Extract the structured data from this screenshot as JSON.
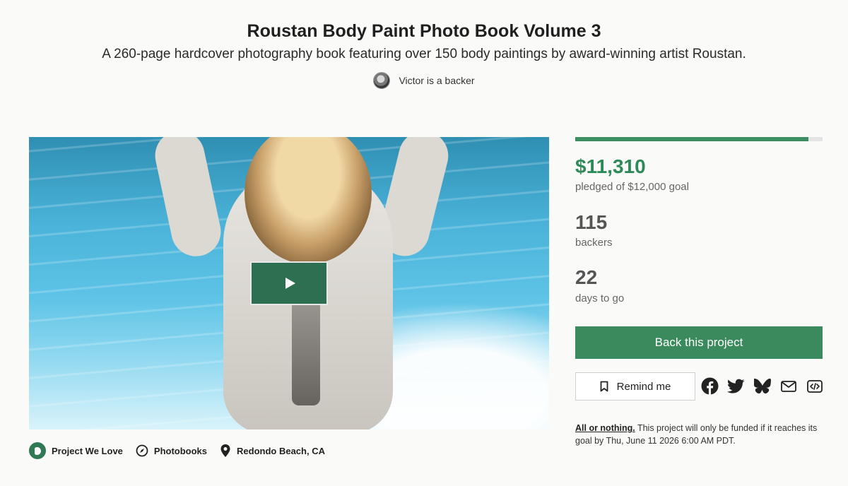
{
  "project": {
    "title": "Roustan Body Paint Photo Book Volume 3",
    "subtitle": "A 260-page hardcover photography book featuring over 150 body paintings by award-winning artist Roustan.",
    "backer_line": "Victor is a backer"
  },
  "video": {
    "play_icon": "play-icon"
  },
  "meta": {
    "project_we_love": "Project We Love",
    "category": "Photobooks",
    "location": "Redondo Beach, CA"
  },
  "stats": {
    "progress_fraction": 0.9425,
    "pledged": "$11,310",
    "pledged_sub": "pledged of $12,000 goal",
    "backers": "115",
    "backers_label": "backers",
    "days": "22",
    "days_label": "days to go"
  },
  "actions": {
    "back_label": "Back this project",
    "remind_label": "Remind me",
    "share_icons": [
      "facebook-icon",
      "twitter-icon",
      "bluesky-icon",
      "email-icon",
      "embed-icon"
    ]
  },
  "funding": {
    "all_or_nothing": "All or nothing.",
    "note": " This project will only be funded if it reaches its goal by Thu, June 11 2026 6:00 AM PDT."
  },
  "colors": {
    "accent": "#3a8a5d",
    "pledged": "#2f8a5a",
    "play_bg": "#2e6f52"
  }
}
